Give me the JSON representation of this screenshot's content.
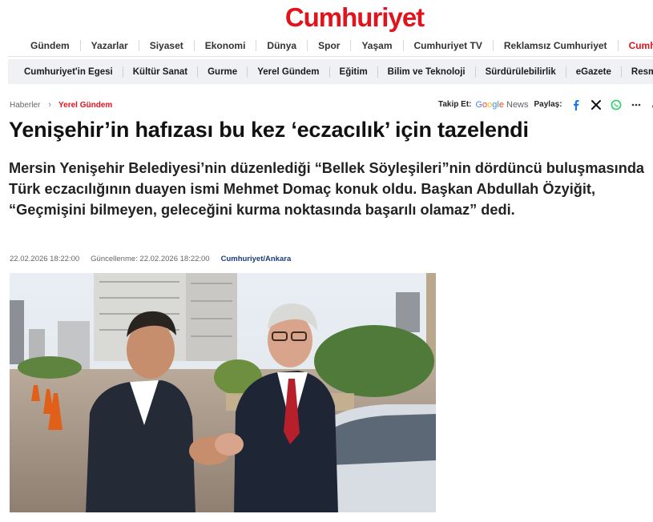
{
  "brand": {
    "logo_text": "Cumhuriyet",
    "color": "#e1141d"
  },
  "nav_primary": [
    "Gündem",
    "Yazarlar",
    "Siyaset",
    "Ekonomi",
    "Dünya",
    "Spor",
    "Yaşam",
    "Cumhuriyet TV",
    "Reklamsız Cumhuriyet",
    "Cumhuriyete"
  ],
  "nav_secondary": [
    "Cumhuriyet'in Egesi",
    "Kültür Sanat",
    "Gurme",
    "Yerel Gündem",
    "Eğitim",
    "Bilim ve Teknoloji",
    "Sürdürülebilirlik",
    "eGazete",
    "Resm"
  ],
  "breadcrumb": {
    "home": "Haberler",
    "separator": "›",
    "category": "Yerel Gündem"
  },
  "follow": {
    "label": "Takip Et:",
    "google": [
      "G",
      "o",
      "o",
      "g",
      "l",
      "e"
    ],
    "news": "News",
    "share_label": "Paylaş:",
    "icons": [
      "facebook-icon",
      "x-icon",
      "whatsapp-icon",
      "more-icon",
      "link-icon"
    ]
  },
  "article": {
    "title": "Yenişehir’in hafızası bu kez ‘eczacılık’ için tazelendi",
    "summary": "Mersin Yenişehir Belediyesi’nin düzenlediği “Bellek Söyleşileri”nin dördüncü buluşmasında Türk eczacılığının duayen ismi Mehmet Domaç konuk oldu. Başkan Abdullah Özyiğit, “Geçmişini bilmeyen, geleceğini kurma noktasında başarılı olamaz” dedi.",
    "published": "22.02.2026 18:22:00",
    "updated": "Güncellenme: 22.02.2026 18:22:00",
    "source": "Cumhuriyet/Ankara"
  }
}
